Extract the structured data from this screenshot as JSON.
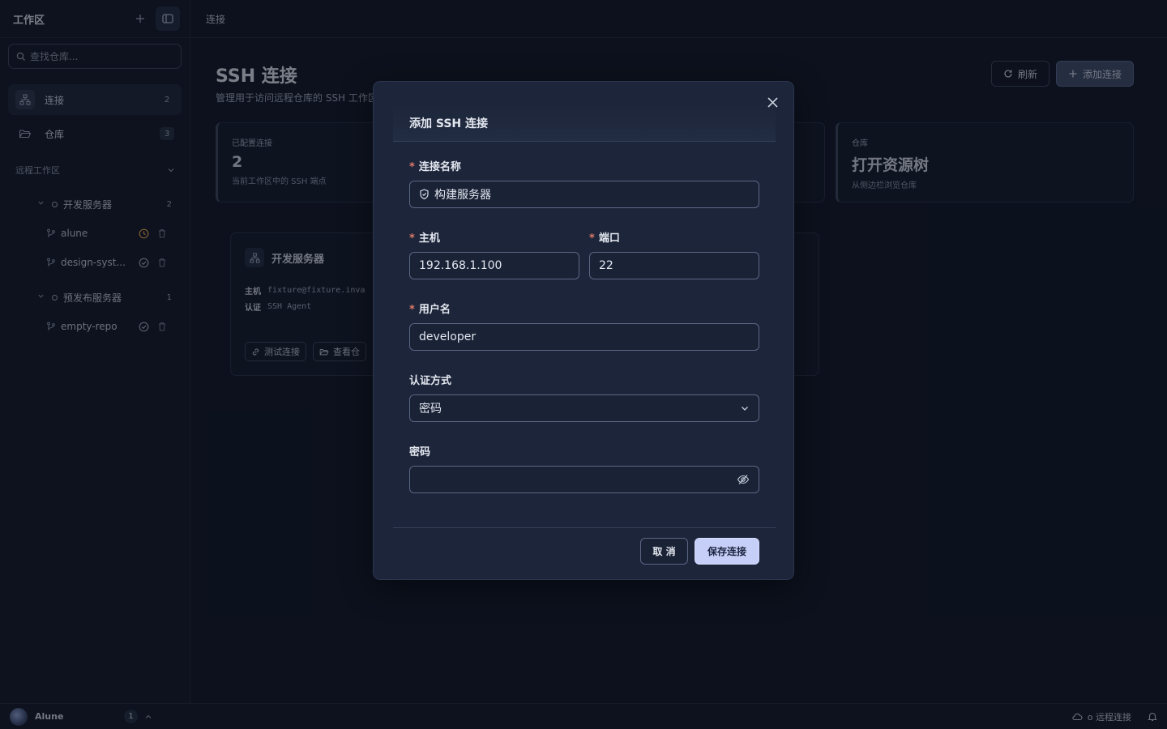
{
  "sidebar": {
    "title": "工作区",
    "search_placeholder": "查找仓库...",
    "nav": [
      {
        "label": "连接",
        "count": "2"
      },
      {
        "label": "仓库",
        "count": "3"
      }
    ],
    "section_title": "远程工作区",
    "groups": [
      {
        "label": "开发服务器",
        "count": "2",
        "repos": [
          "alune",
          "design-syst..."
        ]
      },
      {
        "label": "预发布服务器",
        "count": "1",
        "repos": [
          "empty-repo"
        ]
      }
    ]
  },
  "topbar": {
    "breadcrumb": "连接"
  },
  "page": {
    "title": "SSH 连接",
    "subtitle": "管理用于访问远程仓库的 SSH 工作区",
    "refresh_label": "刷新",
    "add_label": "添加连接",
    "stats": [
      {
        "label": "已配置连接",
        "value": "2",
        "sub": "当前工作区中的 SSH 端点"
      },
      {
        "label": "仓库",
        "value": "打开资源树",
        "sub": "从侧边栏浏览仓库"
      }
    ],
    "card": {
      "title": "开发服务器",
      "host_label": "主机",
      "host_value": "fixture@fixture.inva",
      "auth_label": "认证",
      "auth_value": "SSH Agent",
      "test_label": "测试连接",
      "view_label": "查看仓"
    }
  },
  "modal": {
    "title": "添加 SSH 连接",
    "name_label": "连接名称",
    "name_value": "构建服务器",
    "host_label": "主机",
    "host_value": "192.168.1.100",
    "port_label": "端口",
    "port_value": "22",
    "user_label": "用户名",
    "user_value": "developer",
    "auth_label": "认证方式",
    "auth_value": "密码",
    "password_label": "密码",
    "password_value": "",
    "required_mark": "*",
    "cancel_label": "取 消",
    "save_label": "保存连接"
  },
  "footer": {
    "user": "Alune",
    "count": "1",
    "status": "o 远程连接"
  }
}
